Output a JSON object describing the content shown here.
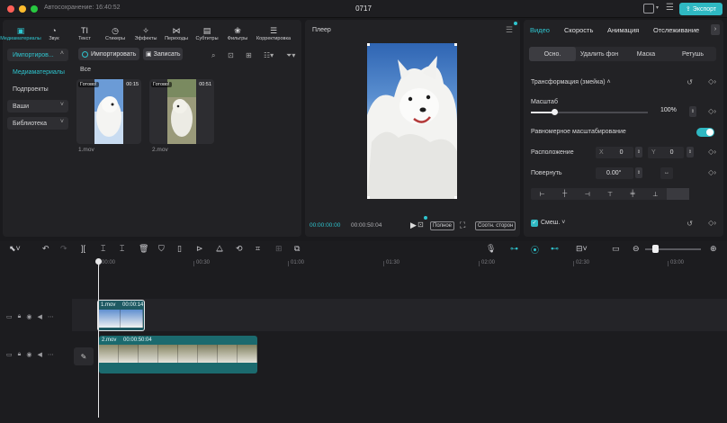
{
  "titlebar": {
    "autosave": "Автосохранение: 16:40:52",
    "project": "0717",
    "export_label": "Экспорт"
  },
  "media": {
    "tabs": [
      {
        "icon": "media-icon",
        "glyph": "▣",
        "label": "Медиаматериалы"
      },
      {
        "icon": "audio-icon",
        "glyph": "◔",
        "label": "Звук"
      },
      {
        "icon": "text-icon",
        "glyph": "TI",
        "label": "Текст"
      },
      {
        "icon": "sticker-icon",
        "glyph": "◷",
        "label": "Стикеры"
      },
      {
        "icon": "effects-icon",
        "glyph": "✧",
        "label": "Эффекты"
      },
      {
        "icon": "transitions-icon",
        "glyph": "⋈",
        "label": "Переходы"
      },
      {
        "icon": "captions-icon",
        "glyph": "▤",
        "label": "Субтитры"
      },
      {
        "icon": "filters-icon",
        "glyph": "❀",
        "label": "Фильтры"
      },
      {
        "icon": "adjust-icon",
        "glyph": "☰",
        "label": "Корректировка"
      }
    ],
    "sidebar": {
      "import": "Импортиров...",
      "media": "Медиаматериалы",
      "subs": "Подпроекты",
      "yours": "Ваши",
      "library": "Библиотека"
    },
    "import_button": "Импортировать",
    "record_button": "Записать",
    "all_label": "Все",
    "items": [
      {
        "badge": "Готово!",
        "duration": "00:15",
        "name": "1.mov"
      },
      {
        "badge": "Готово!",
        "duration": "00:51",
        "name": "2.mov"
      }
    ]
  },
  "player": {
    "title": "Плеер",
    "time_current": "00:00:00:00",
    "time_total": "00:00:50:04",
    "full_label": "Полное",
    "ratio_label": "Соотн. сторон"
  },
  "inspector": {
    "tabs": [
      "Видео",
      "Скорость",
      "Анимация",
      "Отслеживание"
    ],
    "subtabs": [
      "Осно.",
      "Удалить фон",
      "Маска",
      "Ретушь"
    ],
    "transform_label": "Трансформация (змейка)",
    "scale_label": "Масштаб",
    "scale_value": "100%",
    "scale_fraction": 0.2,
    "uniform_label": "Равномерное масштабирование",
    "uniform_on": true,
    "position_label": "Расположение",
    "x_label": "X",
    "x_value": "0",
    "y_label": "Y",
    "y_value": "0",
    "rotate_label": "Повернуть",
    "rotate_value": "0.00°",
    "blend_label": "Смеш.",
    "accent": "#2fc5cf"
  },
  "timeline": {
    "ruler": [
      "00:00",
      "00:30",
      "01:00",
      "01:30",
      "02:00",
      "02:30",
      "03:00"
    ],
    "clip1": {
      "name": "1.mov",
      "duration": "00:00:14"
    },
    "clip2": {
      "name": "2.mov",
      "duration": "00:00:50:04"
    }
  }
}
